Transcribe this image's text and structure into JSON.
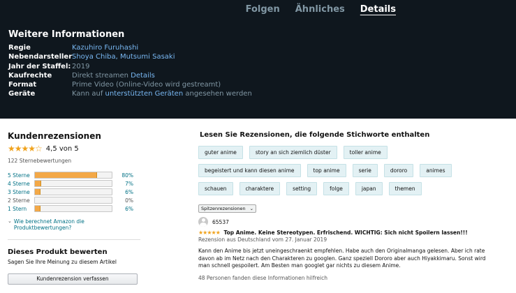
{
  "tabs": [
    {
      "label": "Folgen"
    },
    {
      "label": "Ähnliches"
    },
    {
      "label": "Details"
    }
  ],
  "info": {
    "title": "Weitere Informationen",
    "rows": {
      "regie": {
        "key": "Regie",
        "value": "Kazuhiro Furuhashi"
      },
      "neben": {
        "key": "Nebendarsteller",
        "value": "Shoya Chiba, Mutsumi Sasaki"
      },
      "jahr": {
        "key": "Jahr der Staffel:",
        "value": "2019"
      },
      "kauf": {
        "key": "Kaufrechte",
        "value_prefix": "Direkt streamen ",
        "value_link": "Details"
      },
      "format": {
        "key": "Format",
        "value": "Prime Video (Online-Video wird gestreamt)"
      },
      "geraete": {
        "key": "Geräte",
        "value_prefix": "Kann auf ",
        "value_link": "unterstützten Geräten",
        "value_suffix": " angesehen werden"
      }
    }
  },
  "reviews": {
    "title": "Kundenrezensionen",
    "stars_glyph": "★★★★☆",
    "average": "4,5 von 5",
    "total": "122 Sternebewertungen",
    "histogram": [
      {
        "label": "5 Sterne",
        "pct": "80%",
        "fraction": 0.8
      },
      {
        "label": "4 Sterne",
        "pct": "7%",
        "fraction": 0.07
      },
      {
        "label": "3 Sterne",
        "pct": "6%",
        "fraction": 0.06
      },
      {
        "label": "2 Sterne",
        "pct": "0%",
        "fraction": 0.0
      },
      {
        "label": "1 Stern",
        "pct": "6%",
        "fraction": 0.06
      }
    ],
    "how_link": "Wie berechnet Amazon die Produktbewertungen?",
    "rate_title": "Dieses Produkt bewerten",
    "rate_sub": "Sagen Sie Ihre Meinung zu diesem Artikel",
    "write_button": "Kundenrezension verfassen"
  },
  "keywords": {
    "title": "Lesen Sie Rezensionen, die folgende Stichworte enthalten",
    "chips": [
      "guter anime",
      "story an sich ziemlich düster",
      "toller anime",
      "begeistert und kann diesen anime",
      "top anime",
      "serie",
      "dororo",
      "animes",
      "schauen",
      "charaktere",
      "setting",
      "folge",
      "japan",
      "themen"
    ]
  },
  "sort": {
    "selected": "Spitzenrezensionen"
  },
  "review": {
    "author": "65537",
    "stars_glyph": "★★★★★",
    "headline": "Top Anime. Keine Stereotypen. Erfrischend. WICHTIG: Sich nicht Spoilern lassen!!!",
    "date": "Rezension aus Deutschland vom 27. Januar 2019",
    "body": "Kann den Anime bis jetzt uneingeschraenkt empfehlen. Habe auch den Originalmanga gelesen. Aber ich rate davon ab im Netz nach den Charakteren zu googlen. Ganz speziell Dororo aber auch Hiyakkimaru. Sonst wird man schnell gespoilert. Am Besten man googlet gar nichts zu diesem Anime.",
    "helpful": "48 Personen fanden diese Informationen hilfreich"
  },
  "colors": {
    "header_bg": "#0f171e",
    "link": "#79b8f3",
    "star": "#f0a21b",
    "bar_fill": "#f3a847",
    "chip_bg": "#e3f1f4"
  }
}
